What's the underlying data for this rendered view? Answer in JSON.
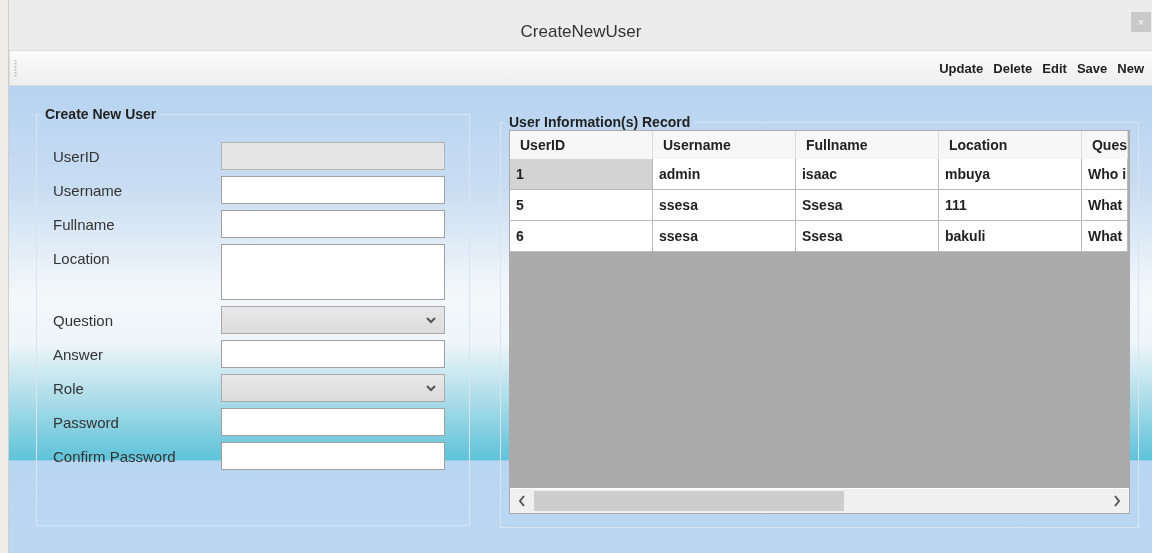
{
  "window": {
    "title": "CreateNewUser",
    "close": "×"
  },
  "toolbar": {
    "buttons": [
      "Update",
      "Delete",
      "Edit",
      "Save",
      "New"
    ]
  },
  "form": {
    "title": "Create New User",
    "fields": [
      {
        "label": "UserID",
        "kind": "text",
        "disabled": true
      },
      {
        "label": "Username",
        "kind": "text",
        "disabled": false
      },
      {
        "label": "Fullname",
        "kind": "text",
        "disabled": false
      },
      {
        "label": "Location",
        "kind": "textarea",
        "disabled": false
      },
      {
        "label": "Question",
        "kind": "select"
      },
      {
        "label": "Answer",
        "kind": "text",
        "disabled": false
      },
      {
        "label": "Role",
        "kind": "select"
      },
      {
        "label": "Password",
        "kind": "text",
        "disabled": false
      },
      {
        "label": "Confirm Password",
        "kind": "text",
        "disabled": false
      }
    ]
  },
  "records": {
    "title": "User Information(s) Record",
    "columns": [
      "UserID",
      "Username",
      "Fullname",
      "Location",
      "Ques"
    ],
    "rows": [
      {
        "cells": [
          "1",
          "admin",
          "isaac",
          "mbuya",
          "Who i"
        ],
        "selected": true
      },
      {
        "cells": [
          "5",
          "ssesa",
          "Ssesa",
          "111",
          "What"
        ],
        "selected": false
      },
      {
        "cells": [
          "6",
          "ssesa",
          "Ssesa",
          "bakuli",
          "What"
        ],
        "selected": false
      }
    ]
  }
}
